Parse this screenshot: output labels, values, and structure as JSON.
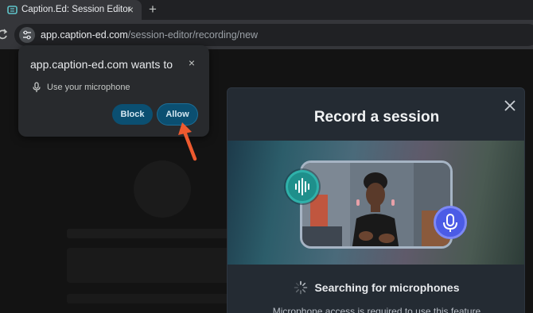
{
  "browser": {
    "tab": {
      "title": "Caption.Ed: Session Editor",
      "close_glyph": "×",
      "favicon": "captioned-logo-icon"
    },
    "new_tab_glyph": "+",
    "reload_glyph": "C",
    "url": {
      "host": "app.caption-ed.com",
      "path": "/session-editor/recording/new"
    }
  },
  "permission_prompt": {
    "title": "app.caption-ed.com wants to",
    "close_glyph": "×",
    "permission": "Use your microphone",
    "block_label": "Block",
    "allow_label": "Allow"
  },
  "modal": {
    "title": "Record a session",
    "status": "Searching for microphones",
    "note": "Microphone access is required to use this feature"
  },
  "colors": {
    "accent_button": "#0b4f71",
    "arrow": "#ee5a2f",
    "wave_bubble": "#1f8f8b",
    "mic_bubble": "#4b5be6"
  }
}
